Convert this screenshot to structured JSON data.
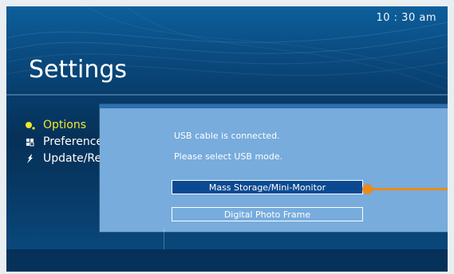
{
  "clock": "10 : 30 am",
  "page_title": "Settings",
  "menu": {
    "items": [
      {
        "label": "Options",
        "icon": "options-icon",
        "active": true
      },
      {
        "label": "Preferences",
        "icon": "preferences-icon",
        "active": false
      },
      {
        "label": "Update/Restore",
        "icon": "update-icon",
        "active": false
      }
    ]
  },
  "dialog": {
    "line1": "USB cable is connected.",
    "line2": "Please select USB mode.",
    "option_selected": "Mass Storage/Mini-Monitor",
    "option_other": "Digital Photo Frame"
  },
  "colors": {
    "accent_yellow": "#f2e72a",
    "dialog_bg": "#77acdc",
    "selected_btn": "#0b4a92",
    "callout": "#ea8b1b"
  }
}
